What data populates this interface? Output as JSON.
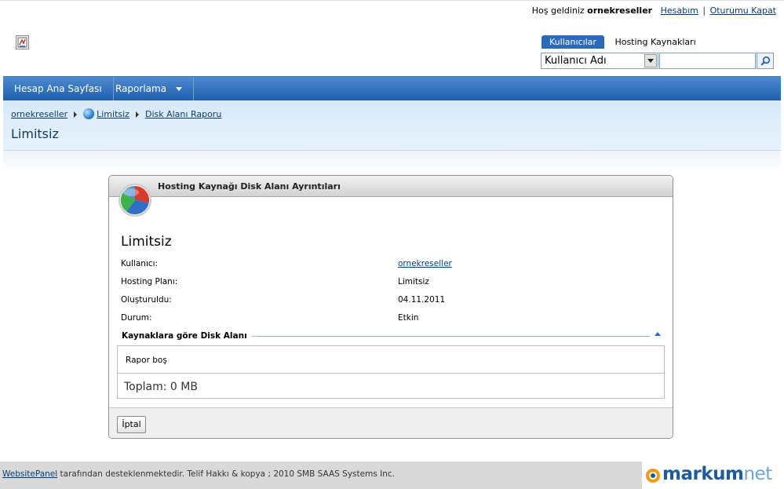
{
  "header": {
    "welcome_prefix": "Hoş geldiniz",
    "username": "ornekreseller",
    "account_link": "Hesabım",
    "separator": "|",
    "logout_link": "Oturumu Kapat"
  },
  "search": {
    "tabs": [
      {
        "label": "Kullanıcılar",
        "active": true
      },
      {
        "label": "Hosting Kaynakları",
        "active": false
      }
    ],
    "selected_field": "Kullanıcı Adı",
    "query": ""
  },
  "nav": {
    "items": [
      {
        "label": "Hesap Ana Sayfası"
      },
      {
        "label": "Raporlama"
      }
    ]
  },
  "breadcrumb": {
    "items": [
      "ornekreseller",
      "Limitsiz",
      "Disk Alanı Raporu"
    ]
  },
  "page": {
    "title": "Limitsiz"
  },
  "panel": {
    "header_title": "Hosting Kaynağı Disk Alanı Ayrıntıları",
    "detail_title": "Limitsiz",
    "rows": [
      {
        "label": "Kullanıcı:",
        "value": "ornekreseller"
      },
      {
        "label": "Hosting Planı:",
        "value": "Limitsiz"
      },
      {
        "label": "Oluşturuldu:",
        "value": "04.11.2011"
      },
      {
        "label": "Durum:",
        "value": "Etkin"
      }
    ],
    "section_title": "Kaynaklara göre Disk Alanı",
    "report_empty": "Rapor boş",
    "report_total": "Toplam: 0 MB",
    "cancel_label": "İptal"
  },
  "footer": {
    "link": "WebsitePanel",
    "text": " tarafından desteklenmektedir. Telif Hakkı & kopya ; 2010 SMB SAAS Systems Inc.",
    "brand_part1": "markum",
    "brand_part2": "net"
  },
  "colors": {
    "nav_blue": "#2b6ab8",
    "crumb_bg": "#d7e9f8",
    "link": "#0a3d6e"
  }
}
